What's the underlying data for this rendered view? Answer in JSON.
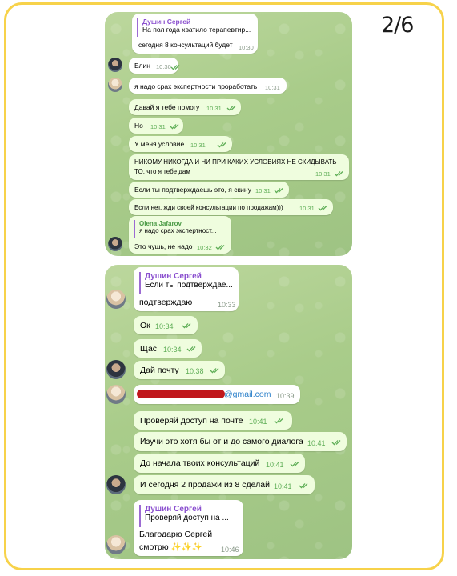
{
  "page_number": "2/6",
  "top_chat": {
    "messages": [
      {
        "reply_name": "Душин Сергей",
        "reply_text": "На пол года хватило терапевтир...",
        "text": "сегодня 8 консультаций будет",
        "time": "10:30"
      },
      {
        "text": "Блин",
        "time": "10:30"
      },
      {
        "text": "я надо срах экспертности проработать",
        "time": "10:31"
      },
      {
        "text": "Давай я тебе помогу",
        "time": "10:31"
      },
      {
        "text": "Но",
        "time": "10:31"
      },
      {
        "text": "У меня условие",
        "time": "10:31"
      },
      {
        "text": "НИКОМУ НИКОГДА И НИ ПРИ КАКИХ УСЛОВИЯХ НЕ СКИДЫВАТЬ",
        "text2": "ТО, что я тебе дам",
        "time": "10:31"
      },
      {
        "text": "Если ты подтверждаешь это, я скину",
        "time": "10:31"
      },
      {
        "text": "Если нет, жди своей консультации по продажам)))",
        "time": "10:31"
      },
      {
        "reply_name": "Olena Jafarov",
        "reply_text": "я надо срах экспертност...",
        "text": "Это чушь, не надо",
        "time": "10:32"
      }
    ]
  },
  "bottom_chat": {
    "messages": [
      {
        "reply_name": "Душин Сергей",
        "reply_text": "Если ты подтверждае...",
        "text": "подтверждаю",
        "time": "10:33"
      },
      {
        "text": "Ок",
        "time": "10:34"
      },
      {
        "text": "Щас",
        "time": "10:34"
      },
      {
        "text": "Дай почту",
        "time": "10:38"
      },
      {
        "text": "@gmail.com",
        "time": "10:39"
      },
      {
        "text": "Проверяй доступ на почте",
        "time": "10:41"
      },
      {
        "text": "Изучи это хотя бы от и до самого диалога",
        "time": "10:41"
      },
      {
        "text": "До начала твоих консультаций",
        "time": "10:41"
      },
      {
        "text": "И сегодня 2 продажи из 8 сделай",
        "time": "10:41"
      },
      {
        "reply_name": "Душин Сергей",
        "reply_text": "Проверяй доступ на ...",
        "text": "Благодарю Сергей",
        "text2": "смотрю ✨✨✨",
        "time": "10:46"
      }
    ]
  },
  "colors": {
    "frame_border": "#f7d24a",
    "incoming_bubble": "#ffffff",
    "outgoing_bubble": "#effdde",
    "reply_accent": "#9c6bd3",
    "read_check": "#5fae57",
    "link": "#2a7fc9"
  }
}
